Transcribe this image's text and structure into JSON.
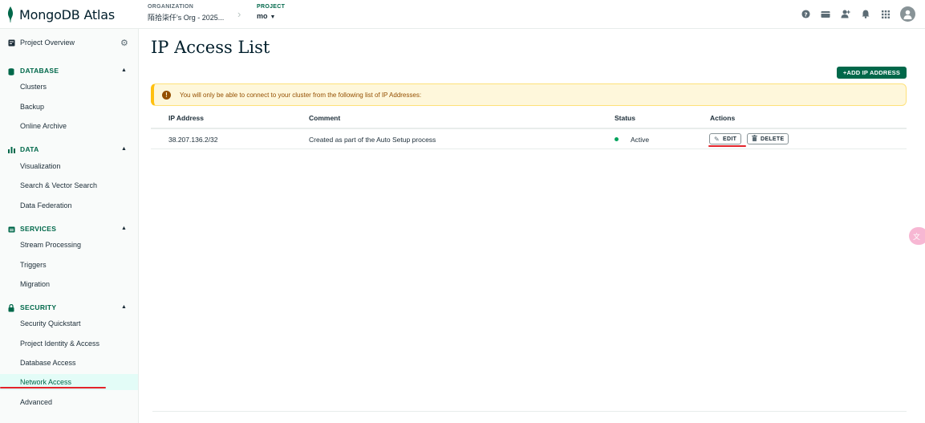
{
  "app": {
    "logo_text": "MongoDB Atlas"
  },
  "topbar": {
    "organization_label": "ORGANIZATION",
    "organization_value": "陌拾柒仟's Org - 2025...",
    "project_label": "PROJECT",
    "project_value": "mo",
    "icons": [
      "help-icon",
      "folder-icon",
      "invite-user-icon",
      "bell-icon",
      "apps-grid-icon",
      "user-avatar-icon"
    ]
  },
  "sidebar": {
    "overview": "Project Overview",
    "sections": [
      {
        "title": "DATABASE",
        "items": [
          "Clusters",
          "Backup",
          "Online Archive"
        ]
      },
      {
        "title": "DATA",
        "items": [
          "Visualization",
          "Search & Vector Search",
          "Data Federation"
        ]
      },
      {
        "title": "SERVICES",
        "items": [
          "Stream Processing",
          "Triggers",
          "Migration"
        ]
      },
      {
        "title": "SECURITY",
        "items": [
          "Security Quickstart",
          "Project Identity & Access",
          "Database Access",
          "Network Access",
          "Advanced"
        ]
      }
    ],
    "active_item": "Network Access"
  },
  "main": {
    "title": "IP Access List",
    "add_button": "+ADD IP ADDRESS",
    "banner_text": "You will only be able to connect to your cluster from the following list of IP Addresses:",
    "columns": [
      "IP Address",
      "Comment",
      "Status",
      "Actions"
    ],
    "rows": [
      {
        "ip": "38.207.136.2/32",
        "comment": "Created as part of the Auto Setup process",
        "status": "Active",
        "edit": "EDIT",
        "delete": "DELETE"
      }
    ]
  },
  "colors": {
    "brand_green": "#00684a",
    "active_bg": "#e3fcf7",
    "warning_bg": "#fef7db",
    "status_active": "#00a35c",
    "annotation_red": "#e3242b"
  }
}
